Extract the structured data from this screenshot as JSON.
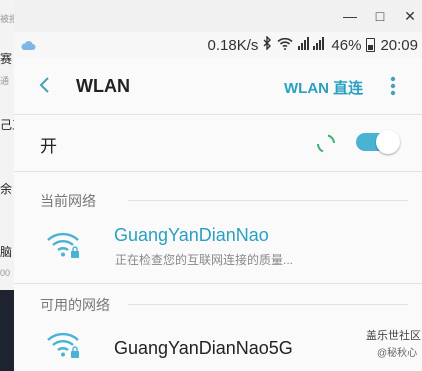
{
  "background_fragments": {
    "frag1": "被报",
    "frag2": "赛",
    "frag3": "通",
    "frag4": "己工",
    "frag5": "余",
    "frag6": "脑",
    "frag7": "00"
  },
  "window_controls": {
    "minimize": "—",
    "maximize": "□",
    "close": "✕"
  },
  "status_bar": {
    "net_speed": "0.18K/s",
    "battery": "46%",
    "time": "20:09"
  },
  "header": {
    "title": "WLAN",
    "direct_label": "WLAN 直连"
  },
  "toggle_row": {
    "label": "开",
    "enabled": true
  },
  "current_network": {
    "section_label": "当前网络",
    "name": "GuangYanDianNao",
    "status": "正在检查您的互联网连接的质量..."
  },
  "available_networks": {
    "section_label": "可用的网络",
    "items": [
      {
        "name": "GuangYanDianNao5G"
      }
    ]
  },
  "watermark": {
    "line1": "盖乐世社区",
    "line2": "@秘秋心"
  },
  "colors": {
    "accent": "#2aa0c0",
    "toggle_track": "#4ab3d3",
    "spinner_green": "#3bb273"
  },
  "icons": {
    "cloud": "cloud-icon",
    "bluetooth": "bluetooth-icon",
    "wifi": "wifi-icon",
    "signal": "signal-icon",
    "battery": "battery-icon",
    "back": "back-arrow-icon",
    "more": "more-vert-icon",
    "wifi_lock": "wifi-lock-icon"
  }
}
